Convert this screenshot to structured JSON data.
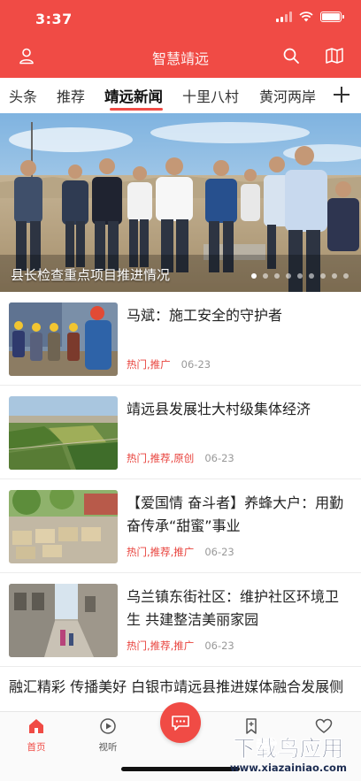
{
  "status_bar": {
    "time": "3:37"
  },
  "header": {
    "title": "智慧靖远",
    "user_icon": "user-icon",
    "search_icon": "search-icon",
    "map_icon": "map-icon",
    "brand_color": "#f04b45"
  },
  "channels": {
    "tabs": [
      "头条",
      "推荐",
      "靖远新闻",
      "十里八村",
      "黄河两岸"
    ],
    "active_index": 2,
    "add_icon": "plus-icon"
  },
  "banner": {
    "caption": "县长检查重点项目推进情况",
    "slide_count": 9,
    "active_slide": 0
  },
  "news": [
    {
      "title": "马斌：施工安全的守护者",
      "tags": "热门,推广",
      "date": "06-23",
      "thumb": "workers-photo"
    },
    {
      "title": "靖远县发展壮大村级集体经济",
      "tags": "热门,推荐,原创",
      "date": "06-23",
      "thumb": "farmland-photo"
    },
    {
      "title": "【爱国情 奋斗者】养蜂大户：用勤奋传承“甜蜜”事业",
      "tags": "热门,推荐,推广",
      "date": "06-23",
      "thumb": "beehives-photo"
    },
    {
      "title": "乌兰镇东街社区：维护社区环境卫生 共建整洁美丽家园",
      "tags": "热门,推荐,推广",
      "date": "06-23",
      "thumb": "street-photo"
    }
  ],
  "news_text_only": {
    "title": "融汇精彩 传播美好 白银市靖远县推进媒体融合发展侧"
  },
  "tabbar": {
    "items": [
      {
        "label": "首页",
        "icon": "home-icon"
      },
      {
        "label": "视听",
        "icon": "play-icon"
      },
      {
        "label": "",
        "icon": "chat-icon"
      },
      {
        "label": "",
        "icon": "bookmark-icon"
      },
      {
        "label": "",
        "icon": "heart-icon"
      }
    ],
    "active_index": 0
  },
  "watermark": {
    "text": "下载与应用",
    "url": "www.xiazainiao.com"
  }
}
